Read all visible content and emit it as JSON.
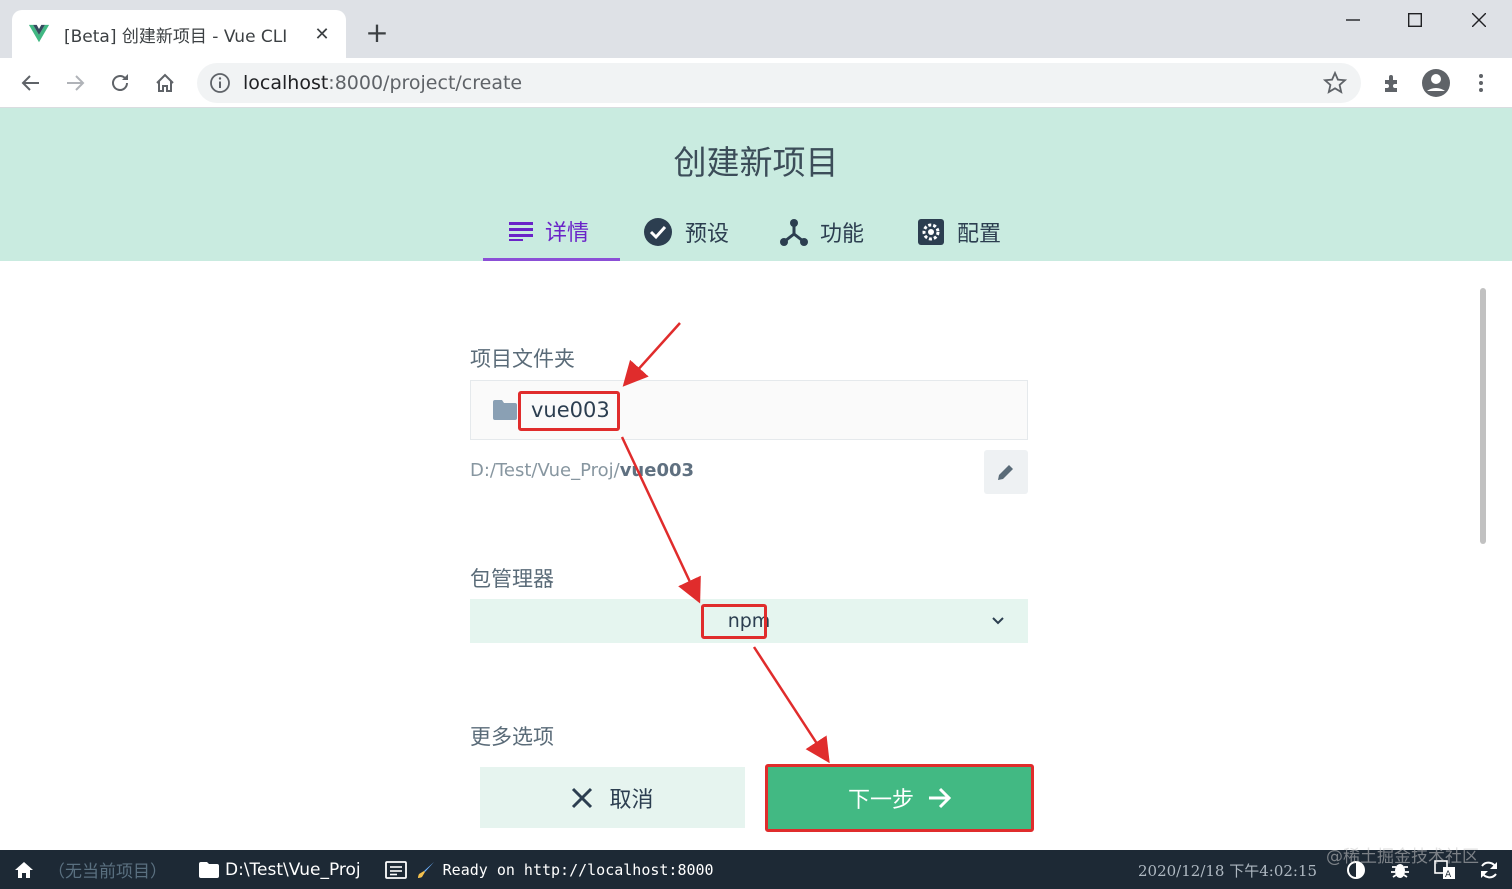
{
  "browser": {
    "tab_title": "[Beta] 创建新项目 - Vue CLI",
    "url_host": "localhost",
    "url_path": ":8000/project/create"
  },
  "app": {
    "page_title": "创建新项目",
    "tabs": [
      {
        "label": "详情",
        "icon": "details-list-icon",
        "active": true
      },
      {
        "label": "预设",
        "icon": "check-circle-icon",
        "active": false
      },
      {
        "label": "功能",
        "icon": "fork-icon",
        "active": false
      },
      {
        "label": "配置",
        "icon": "settings-icon",
        "active": false
      }
    ],
    "project_folder_label": "项目文件夹",
    "project_folder_value": "vue003",
    "path_prefix": "D:/Test/Vue_Proj/",
    "path_suffix": "vue003",
    "package_manager_label": "包管理器",
    "package_manager_value": "npm",
    "more_options_label": "更多选项",
    "cancel_label": "取消",
    "next_label": "下一步"
  },
  "statusbar": {
    "no_project": "（无当前项目）",
    "cwd": "D:\\Test\\Vue_Proj",
    "log": "Ready on http://localhost:8000",
    "datetime": "2020/12/18 下午4:02:15"
  },
  "watermark": "@稀土掘金技术社区",
  "colors": {
    "header_bg": "#c9ebe0",
    "accent_purple": "#6a23c8",
    "primary_green": "#42b983",
    "annotation_red": "#e02c2c",
    "statusbar_bg": "#1d2935"
  }
}
